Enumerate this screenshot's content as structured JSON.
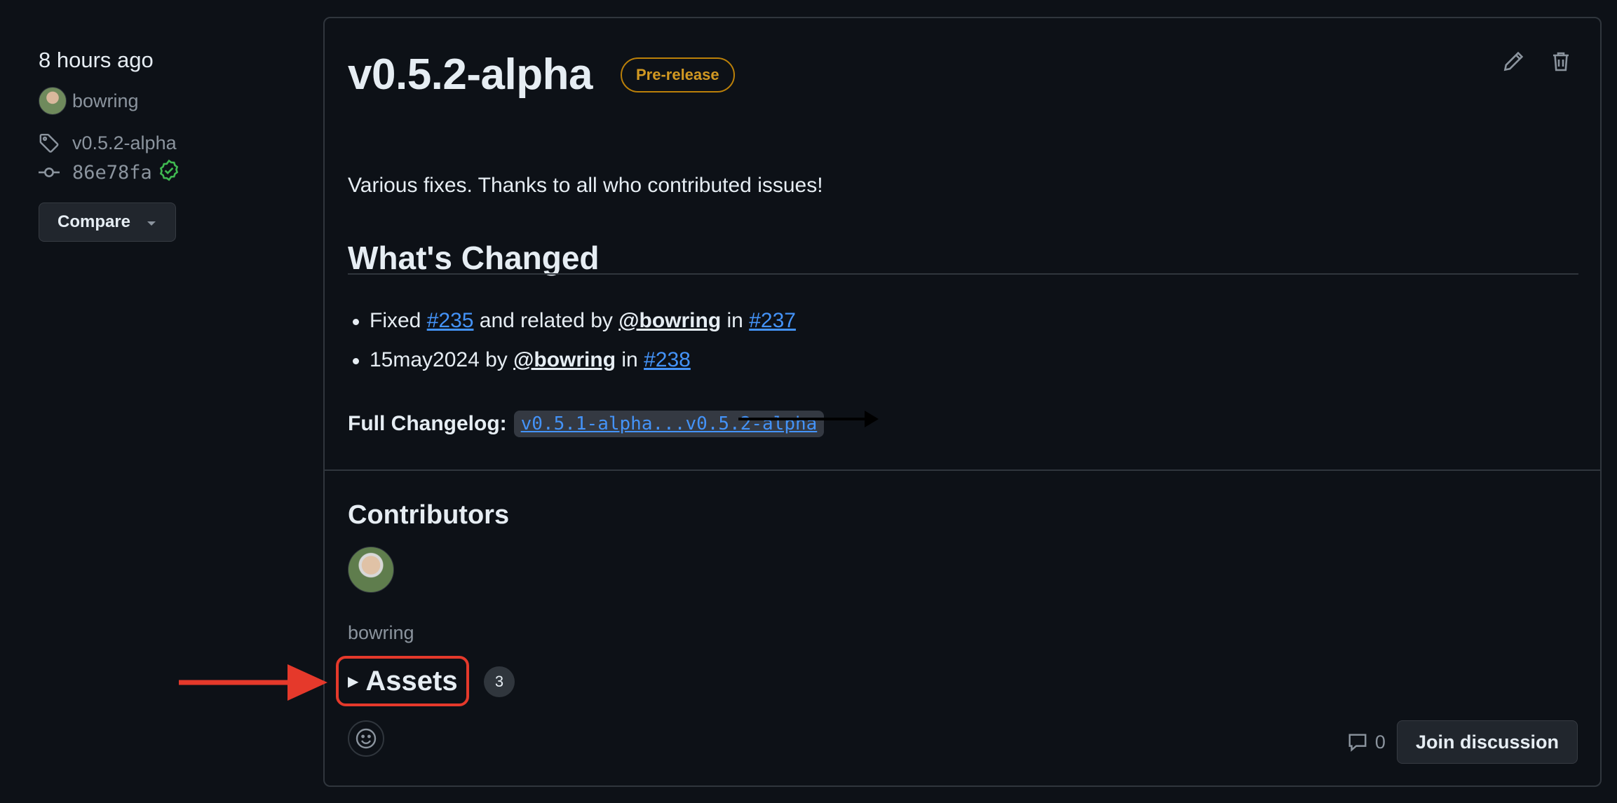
{
  "sidebar": {
    "time": "8 hours ago",
    "author": "bowring",
    "tag": "v0.5.2-alpha",
    "commit": "86e78fa",
    "compare_label": "Compare"
  },
  "release": {
    "title": "v0.5.2-alpha",
    "badge": "Pre-release",
    "description": "Various fixes. Thanks to all who contributed issues!",
    "changes_heading": "What's Changed",
    "changes": [
      {
        "prefix": "Fixed ",
        "link1": "#235",
        "mid": " and related by ",
        "mention": "@bowring",
        "in": " in ",
        "link2": "#237"
      },
      {
        "prefix": "15may2024 by ",
        "mention": "@bowring",
        "in": " in ",
        "link2": "#238"
      }
    ],
    "changelog_label": "Full Changelog:",
    "changelog_link": "v0.5.1-alpha...v0.5.2-alpha"
  },
  "contributors": {
    "heading": "Contributors",
    "name": "bowring"
  },
  "assets": {
    "label": "Assets",
    "count": "3"
  },
  "discussion": {
    "comment_count": "0",
    "join_label": "Join discussion"
  },
  "colors": {
    "background": "#0d1117",
    "link": "#4493f8",
    "prerelease": "#d29922",
    "annotation": "#e5392b",
    "verified": "#3fb950"
  },
  "icons": [
    "tag-icon",
    "commit-icon",
    "verified-icon",
    "pencil-icon",
    "trash-icon",
    "smiley-icon",
    "comment-icon",
    "triangle-right-icon",
    "caret-down-icon"
  ]
}
